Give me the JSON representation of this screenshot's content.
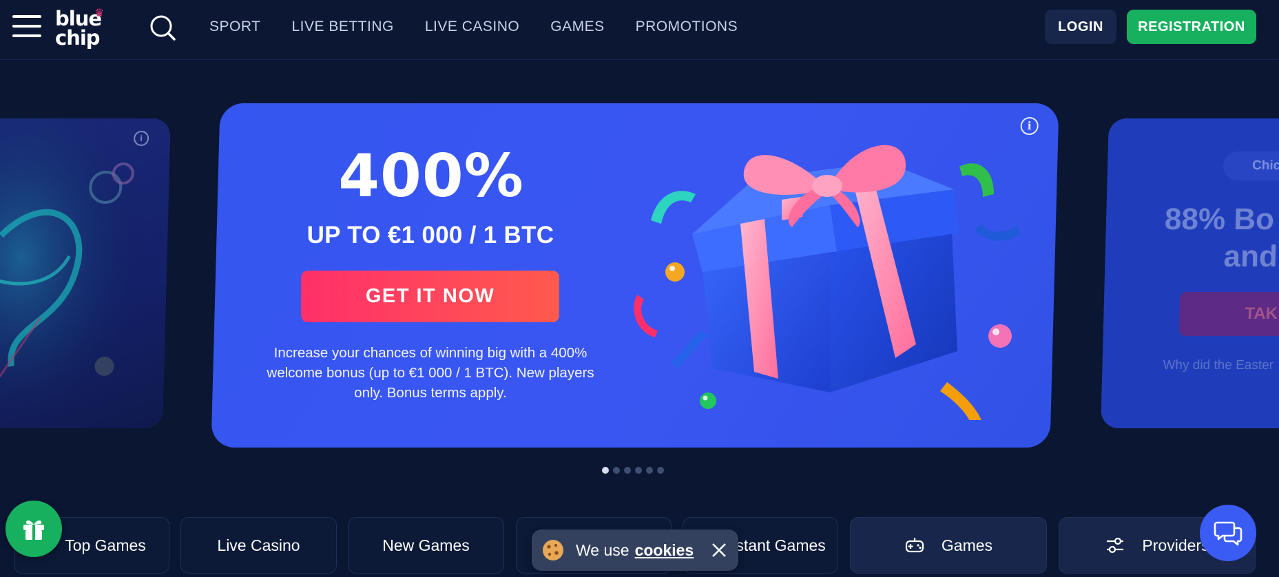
{
  "header": {
    "logo_line1": "blue",
    "logo_line2": "chip",
    "nav": [
      "SPORT",
      "LIVE BETTING",
      "LIVE CASINO",
      "GAMES",
      "PROMOTIONS"
    ],
    "login_label": "LOGIN",
    "registration_label": "REGISTRATION"
  },
  "slider": {
    "main": {
      "title": "400%",
      "subtitle": "UP TO €1 000 / 1 BTC",
      "button_label": "GET IT NOW",
      "description": "Increase your chances of winning big with a 400% welcome bonus (up to €1 000 / 1 BTC). New players only. Bonus terms apply."
    },
    "right_peek": {
      "chip_label": "Chic",
      "title_line1": "88% Bo",
      "title_line2": "and",
      "button_label": "TAK",
      "text_line1": "Why did the Easter",
      "text_line2": ""
    },
    "dots_count": 6,
    "active_dot": 0
  },
  "categories": [
    "Top Games",
    "Live Casino",
    "New Games",
    "",
    "Instant Games",
    "Games",
    "Providers"
  ],
  "cookie_banner": {
    "text": "We use",
    "link": "cookies"
  },
  "colors": {
    "background": "#0a1632",
    "accent_green": "#16b05f",
    "promo_blue": "#3556f0",
    "cta_gradient_start": "#ff2f6a",
    "cta_gradient_end": "#ff5a4d"
  },
  "icons": [
    "menu-icon",
    "search-icon",
    "info-icon",
    "gift-icon",
    "gamepad-icon",
    "sliders-icon",
    "chat-icon",
    "cookie-icon",
    "close-icon"
  ]
}
